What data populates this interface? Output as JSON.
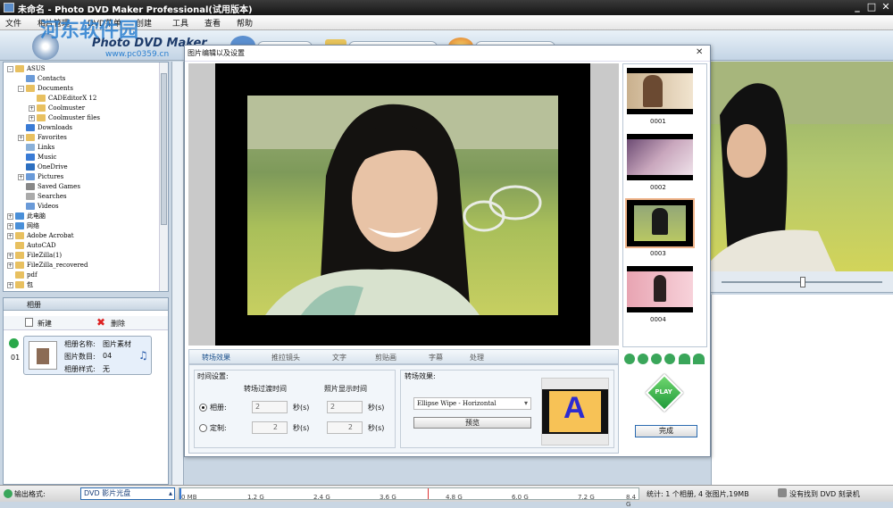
{
  "window": {
    "title": "未命名 - Photo DVD Maker Professional(试用版本)",
    "min": "_",
    "max": "□",
    "close": "✕"
  },
  "menu": [
    "文件",
    "相片管理",
    "DVD菜单",
    "创建",
    "工具",
    "查看",
    "帮助"
  ],
  "banner": {
    "logo": "Photo DVD Maker",
    "watermark": "河东软件园",
    "url": "www.pc0359.cn"
  },
  "tree": [
    {
      "label": "ASUS",
      "indent": 1,
      "exp": "-",
      "icon": "#e8c060"
    },
    {
      "label": "Contacts",
      "indent": 2,
      "exp": "",
      "icon": "#6a9ad8"
    },
    {
      "label": "Documents",
      "indent": 2,
      "exp": "-",
      "icon": "#e8c060"
    },
    {
      "label": "CADEditorX 12",
      "indent": 3,
      "exp": "",
      "icon": "#e8c060"
    },
    {
      "label": "Coolmuster",
      "indent": 3,
      "exp": "+",
      "icon": "#e8c060"
    },
    {
      "label": "Coolmuster files",
      "indent": 3,
      "exp": "+",
      "icon": "#e8c060"
    },
    {
      "label": "Downloads",
      "indent": 2,
      "exp": "",
      "icon": "#3a7bd5"
    },
    {
      "label": "Favorites",
      "indent": 2,
      "exp": "+",
      "icon": "#e8c060"
    },
    {
      "label": "Links",
      "indent": 2,
      "exp": "",
      "icon": "#8ab0d8"
    },
    {
      "label": "Music",
      "indent": 2,
      "exp": "",
      "icon": "#3a7bd5"
    },
    {
      "label": "OneDrive",
      "indent": 2,
      "exp": "",
      "icon": "#2d6fc0"
    },
    {
      "label": "Pictures",
      "indent": 2,
      "exp": "+",
      "icon": "#6a9ad8"
    },
    {
      "label": "Saved Games",
      "indent": 2,
      "exp": "",
      "icon": "#888"
    },
    {
      "label": "Searches",
      "indent": 2,
      "exp": "",
      "icon": "#aaa"
    },
    {
      "label": "Videos",
      "indent": 2,
      "exp": "",
      "icon": "#6a9ad8"
    },
    {
      "label": "此电脑",
      "indent": 1,
      "exp": "+",
      "icon": "#4a8fd8"
    },
    {
      "label": "网络",
      "indent": 1,
      "exp": "+",
      "icon": "#4a8fd8"
    },
    {
      "label": "Adobe Acrobat",
      "indent": 1,
      "exp": "+",
      "icon": "#e8c060"
    },
    {
      "label": "AutoCAD",
      "indent": 1,
      "exp": "",
      "icon": "#e8c060"
    },
    {
      "label": "FileZilla(1)",
      "indent": 1,
      "exp": "+",
      "icon": "#e8c060"
    },
    {
      "label": "FileZilla_recovered",
      "indent": 1,
      "exp": "+",
      "icon": "#e8c060"
    },
    {
      "label": "pdf",
      "indent": 1,
      "exp": "",
      "icon": "#e8c060"
    },
    {
      "label": "包",
      "indent": 1,
      "exp": "+",
      "icon": "#e8c060"
    }
  ],
  "album": {
    "header": "相册",
    "new": "新建",
    "delete": "删除",
    "row": "01",
    "name_label": "相册名称:",
    "name": "图片素材",
    "count_label": "图片数目:",
    "count": "04",
    "style_label": "相册样式:",
    "style": "无"
  },
  "dialog": {
    "title": "图片编辑以及设置",
    "close": "✕",
    "tabs": [
      "转场效果",
      "推拉镜头",
      "文字",
      "剪贴画",
      "字幕",
      "处理"
    ],
    "time_group": "时间设置:",
    "col1": "转场过渡时间",
    "col2": "照片显示时间",
    "radio1": "相册:",
    "radio2": "定制:",
    "val": "2",
    "unit": "秒(s)",
    "effect_group": "转场效果:",
    "effect": "Ellipse Wipe - Horizontal",
    "preview": "预览",
    "letter": "A",
    "thumbs": [
      "0001",
      "0002",
      "0003",
      "0004"
    ],
    "finish": "完成",
    "play": "PLAY"
  },
  "status": {
    "format_label": "输出格式:",
    "format": "DVD 影片光盘",
    "ticks": [
      "0 MB",
      "1.2 G",
      "2.4 G",
      "3.6 G",
      "4.8 G",
      "6.0 G",
      "7.2 G",
      "8.4 G"
    ],
    "stats": "统计: 1 个相册, 4 张图片,19MB",
    "burner": "没有找到 DVD 刻录机"
  }
}
